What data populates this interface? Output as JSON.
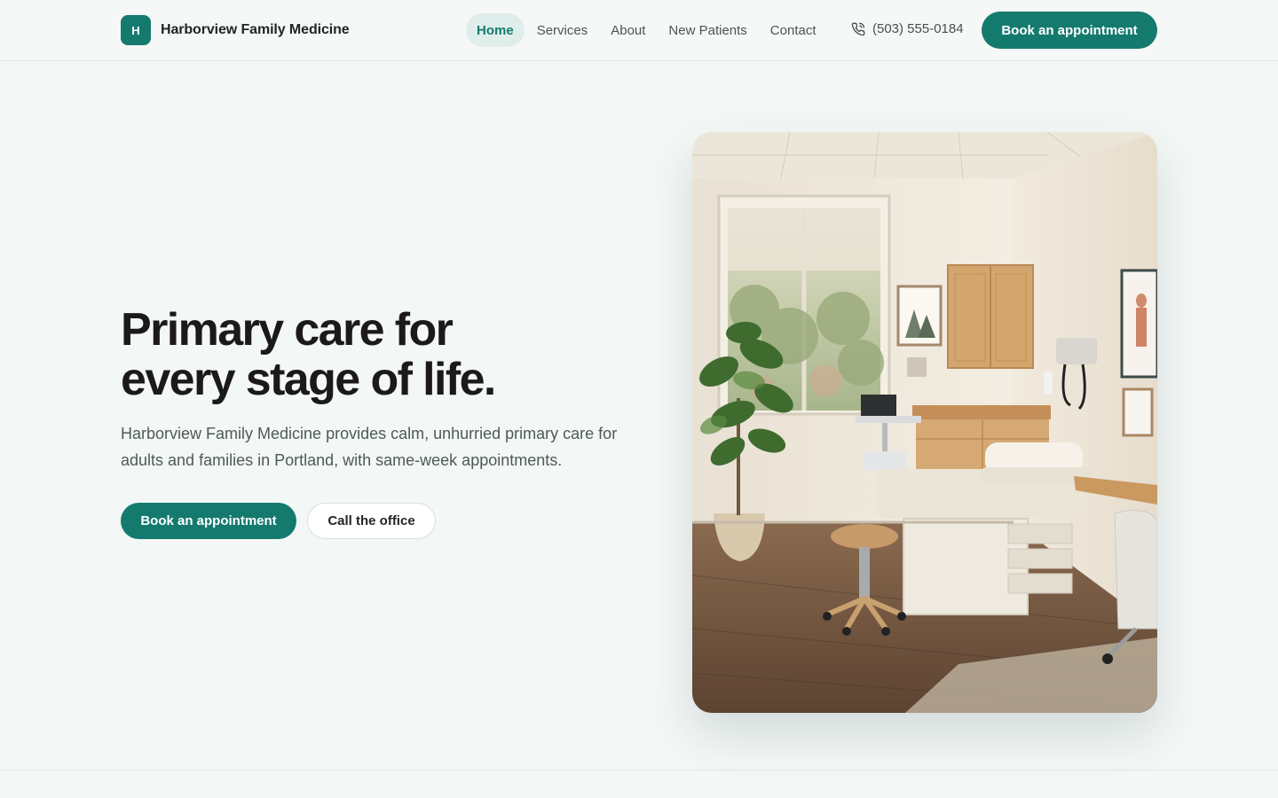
{
  "brand": {
    "initial": "H",
    "name": "Harborview Family Medicine",
    "accent": "#157a6e"
  },
  "nav": {
    "items": [
      {
        "label": "Home",
        "active": true
      },
      {
        "label": "Services",
        "active": false
      },
      {
        "label": "About",
        "active": false
      },
      {
        "label": "New Patients",
        "active": false
      },
      {
        "label": "Contact",
        "active": false
      }
    ],
    "phone": {
      "icon": "phone-icon",
      "number": "(503) 555-0184"
    },
    "cta_label": "Book an appointment"
  },
  "hero": {
    "title_line1": "Primary care for",
    "title_line2": "every stage of life.",
    "subtitle": "Harborview Family Medicine provides calm, unhurried primary care for adults and families in Portland, with same-week appointments.",
    "primary_cta": "Book an appointment",
    "secondary_cta": "Call the office",
    "image": {
      "subject": "clinic-exam-room-photo"
    }
  }
}
